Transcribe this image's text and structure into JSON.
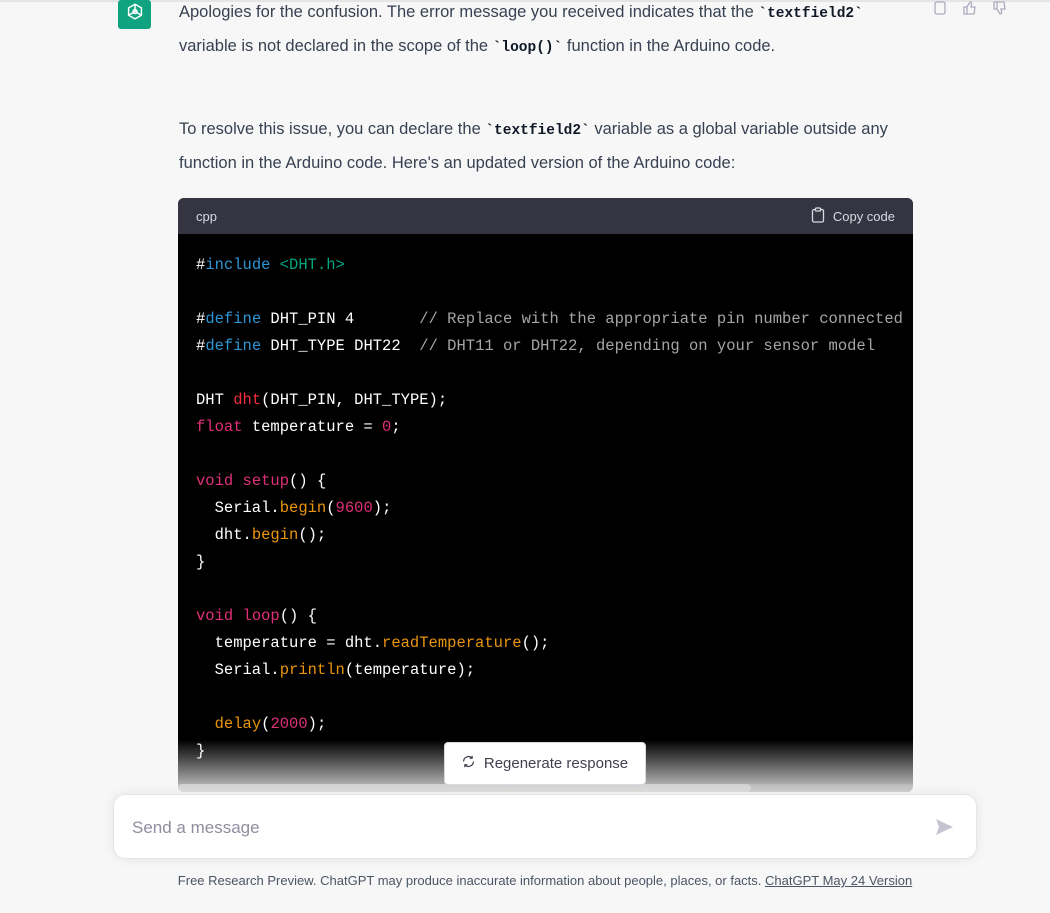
{
  "message": {
    "p1_a": "Apologies for the confusion. The error message you received indicates that the ",
    "p1_code1": "`textfield2`",
    "p1_b": " variable is not declared in the scope of the ",
    "p1_code2": "`loop()`",
    "p1_c": " function in the Arduino code.",
    "p2_a": "To resolve this issue, you can declare the ",
    "p2_code": "`textfield2`",
    "p2_b": " variable as a global variable outside any function in the Arduino code. Here's an updated version of the Arduino code:"
  },
  "codeblock": {
    "language": "cpp",
    "copy_label": "Copy code",
    "lines": [
      "#include <DHT.h>",
      "",
      "#define DHT_PIN 4       // Replace with the appropriate pin number connected",
      "#define DHT_TYPE DHT22  // DHT11 or DHT22, depending on your sensor model",
      "",
      "DHT dht(DHT_PIN, DHT_TYPE);",
      "float temperature = 0;",
      "",
      "void setup() {",
      "  Serial.begin(9600);",
      "  dht.begin();",
      "}",
      "",
      "void loop() {",
      "  temperature = dht.readTemperature();",
      "  Serial.println(temperature);",
      "",
      "  delay(2000);",
      "}"
    ]
  },
  "regenerate_label": "Regenerate response",
  "input": {
    "placeholder": "Send a message",
    "value": ""
  },
  "footer": {
    "text": "Free Research Preview. ChatGPT may produce inaccurate information about people, places, or facts. ",
    "link": "ChatGPT May 24 Version"
  },
  "colors": {
    "brand": "#10a37f",
    "code_bg": "#000000",
    "code_header": "#343541"
  },
  "icons": [
    "openai-logo-icon",
    "copy-icon",
    "thumbs-up-icon",
    "thumbs-down-icon",
    "clipboard-icon",
    "refresh-icon",
    "send-icon"
  ]
}
